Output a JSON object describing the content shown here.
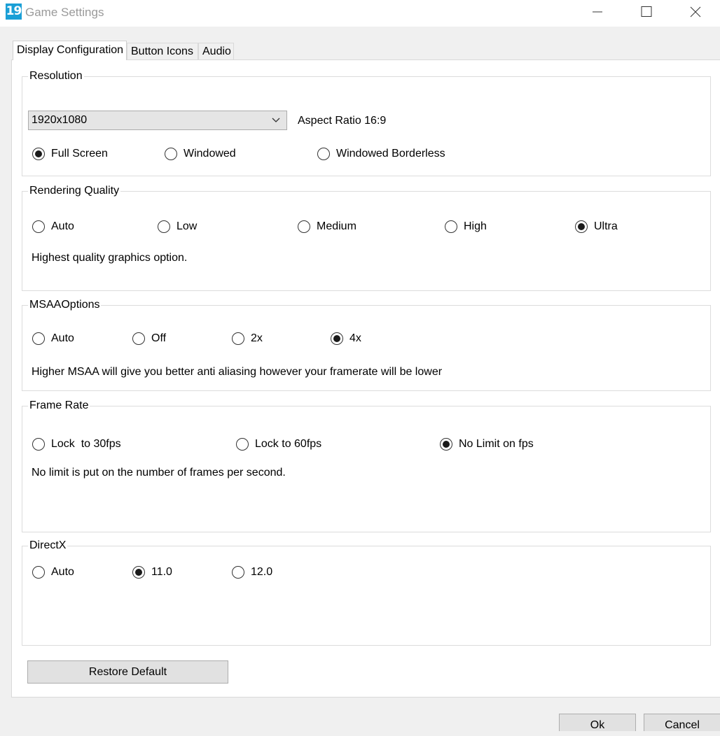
{
  "window": {
    "app_icon_text": "19",
    "title": "Game Settings"
  },
  "tabs": [
    {
      "label": "Display Configuration",
      "active": true
    },
    {
      "label": "Button Icons"
    },
    {
      "label": "Audio"
    }
  ],
  "resolution": {
    "label": "Resolution",
    "selected": "1920x1080",
    "aspect_ratio": "Aspect Ratio 16:9",
    "modes": [
      "Full Screen",
      "Windowed",
      "Windowed Borderless"
    ],
    "selected_mode": "Full Screen"
  },
  "rendering_quality": {
    "label": "Rendering Quality",
    "options": [
      "Auto",
      "Low",
      "Medium",
      "High",
      "Ultra"
    ],
    "selected": "Ultra",
    "description": "Highest quality graphics option."
  },
  "msaa": {
    "label": "MSAAOptions",
    "options": [
      "Auto",
      "Off",
      "2x",
      "4x"
    ],
    "selected": "4x",
    "description": "Higher MSAA will give you better anti aliasing however your framerate will be lower"
  },
  "frame_rate": {
    "label": "Frame Rate",
    "options": [
      "Lock  to 30fps",
      "Lock to 60fps",
      "No Limit on fps"
    ],
    "selected": "No Limit on fps",
    "description": "No limit is put on the number of frames per second."
  },
  "directx": {
    "label": "DirectX",
    "options": [
      "Auto",
      "11.0",
      "12.0"
    ],
    "selected": "11.0"
  },
  "restore_label": "Restore Default",
  "footer": {
    "ok_label": "Ok",
    "cancel_label": "Cancel"
  }
}
